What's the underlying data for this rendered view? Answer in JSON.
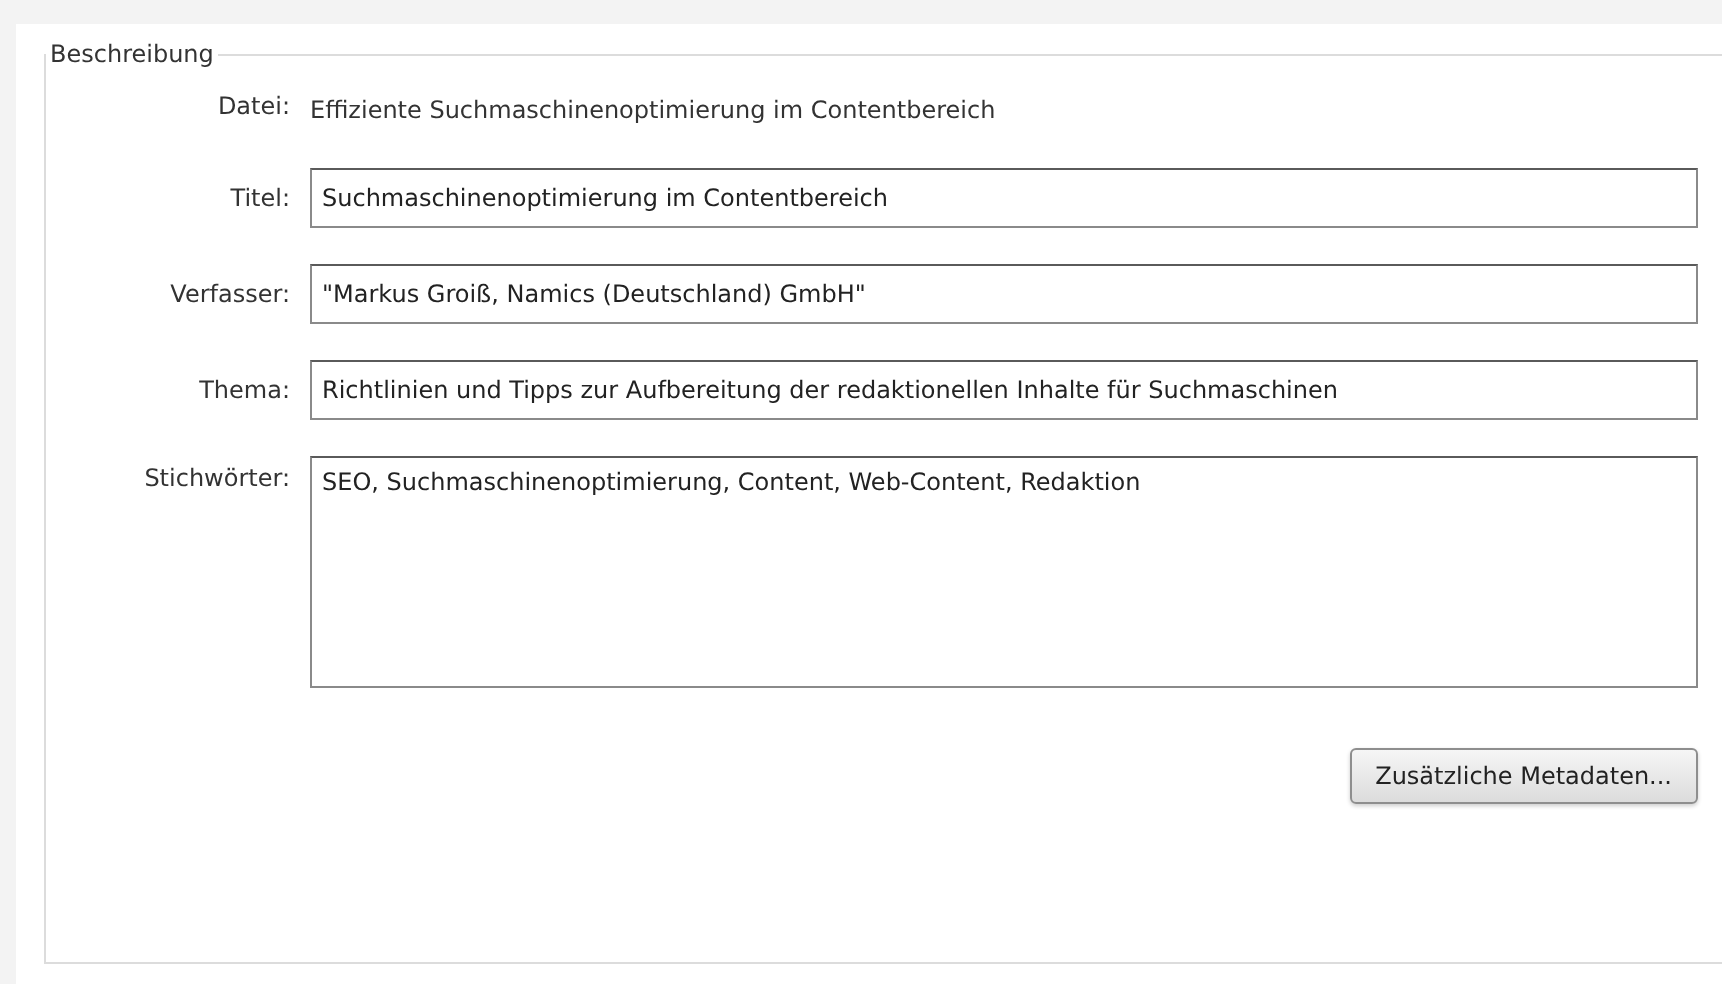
{
  "group": {
    "title": "Beschreibung",
    "fields": [
      {
        "label": "Datei:",
        "kind": "text",
        "value": "Effiziente Suchmaschinenoptimierung im Contentbereich"
      },
      {
        "label": "Titel:",
        "kind": "input",
        "value": "Suchmaschinenoptimierung im Contentbereich"
      },
      {
        "label": "Verfasser:",
        "kind": "input",
        "value": "\"Markus Groiß, Namics (Deutschland) GmbH\""
      },
      {
        "label": "Thema:",
        "kind": "input",
        "value": "Richtlinien und Tipps zur Aufbereitung der redaktionellen Inhalte für Suchmaschinen"
      },
      {
        "label": "Stichwörter:",
        "kind": "textarea",
        "value": "SEO, Suchmaschinenoptimierung, Content, Web-Content, Redaktion"
      }
    ],
    "button": "Zusätzliche Metadaten..."
  }
}
